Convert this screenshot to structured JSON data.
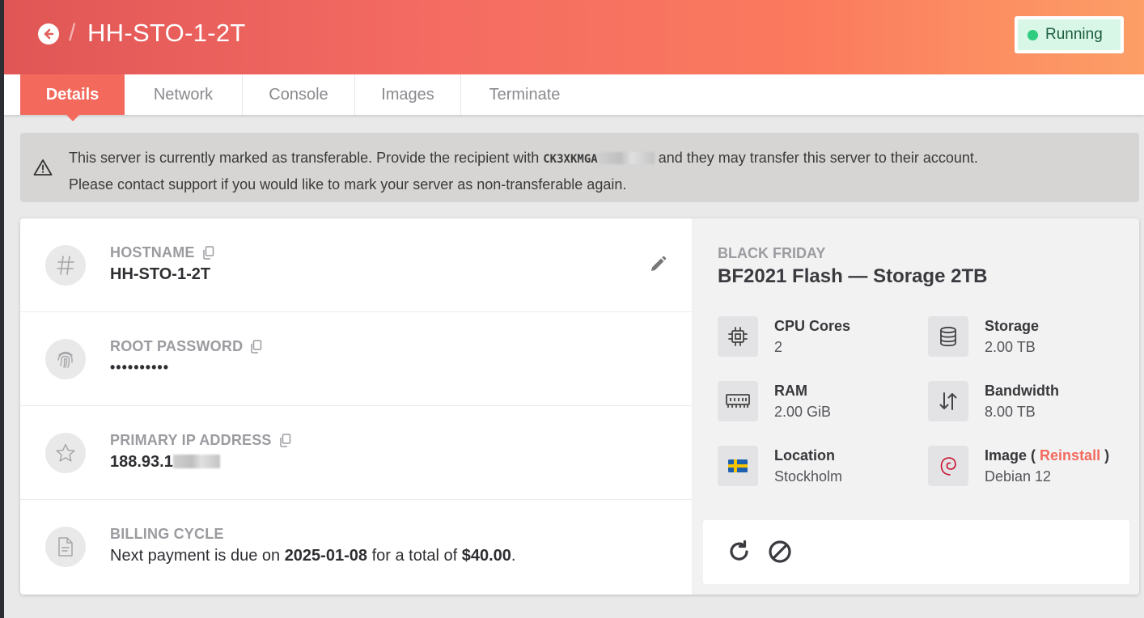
{
  "header": {
    "title": "HH-STO-1-2T",
    "separator": "/",
    "status": "Running",
    "status_color": "#2dcc7f",
    "back_icon": "arrow-left-circle-icon"
  },
  "tabs": [
    {
      "label": "Details",
      "active": true
    },
    {
      "label": "Network",
      "active": false
    },
    {
      "label": "Console",
      "active": false
    },
    {
      "label": "Images",
      "active": false
    },
    {
      "label": "Terminate",
      "active": false
    }
  ],
  "notice": {
    "line1_prefix": "This server is currently marked as transferable. Provide the recipient with",
    "code_visible": "CK3XKMGA",
    "line1_suffix": "and they may transfer this server to their account.",
    "line2": "Please contact support if you would like to mark your server as non-transferable again."
  },
  "details": {
    "hostname": {
      "label": "HOSTNAME",
      "value": "HH-STO-1-2T"
    },
    "root_password": {
      "label": "ROOT PASSWORD",
      "value": "••••••••••"
    },
    "primary_ip": {
      "label": "PRIMARY IP ADDRESS",
      "value_visible": "188.93.1"
    },
    "billing": {
      "label": "BILLING CYCLE",
      "text_prefix": "Next payment is due on",
      "due_date": "2025-01-08",
      "text_mid": "for a total of",
      "amount": "$40.00",
      "text_suffix": "."
    }
  },
  "plan": {
    "group": "BLACK FRIDAY",
    "name": "BF2021 Flash — Storage 2TB",
    "specs": {
      "cpu": {
        "label": "CPU Cores",
        "value": "2",
        "icon": "cpu-icon"
      },
      "storage": {
        "label": "Storage",
        "value": "2.00 TB",
        "icon": "database-icon"
      },
      "ram": {
        "label": "RAM",
        "value": "2.00 GiB",
        "icon": "memory-icon"
      },
      "bandwidth": {
        "label": "Bandwidth",
        "value": "8.00 TB",
        "icon": "transfer-arrows-icon"
      },
      "location": {
        "label": "Location",
        "value": "Stockholm",
        "icon": "sweden-flag-icon"
      },
      "image": {
        "label_prefix": "Image (",
        "reinstall": "Reinstall",
        "label_suffix": ")",
        "value": "Debian 12",
        "icon": "debian-icon"
      }
    }
  },
  "colors": {
    "accent": "#f36a5c",
    "header_gradient_start": "#e05656",
    "header_gradient_end": "#fc9e66"
  }
}
